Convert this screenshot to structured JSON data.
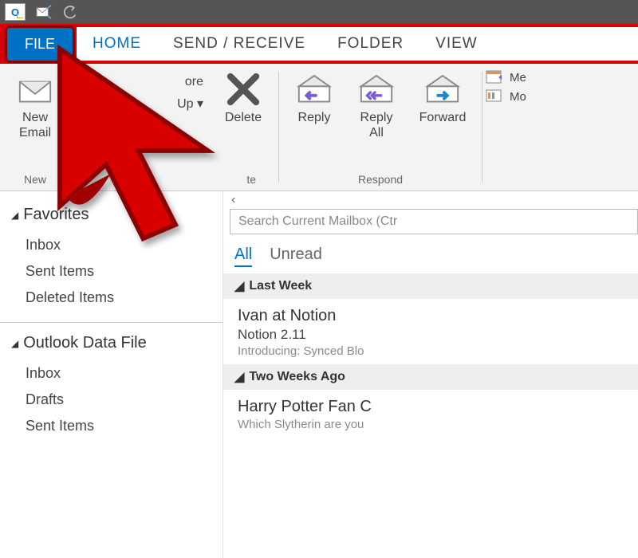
{
  "tabs": {
    "file": "FILE",
    "home": "HOME",
    "sendreceive": "SEND / RECEIVE",
    "folder": "FOLDER",
    "view": "VIEW"
  },
  "ribbon": {
    "new_email": "New\nEmail",
    "new_group": "New",
    "ignore_partial": "ore",
    "cleanup_partial": "Up ▾",
    "delete": "Delete",
    "delete_group": "te",
    "reply": "Reply",
    "reply_all": "Reply\nAll",
    "forward": "Forward",
    "respond_group": "Respond",
    "meeting_partial": "Me",
    "more_partial": "Mo"
  },
  "nav": {
    "favorites": "Favorites",
    "inbox": "Inbox",
    "sent": "Sent Items",
    "deleted": "Deleted Items",
    "datafile": "Outlook Data File",
    "drafts": "Drafts"
  },
  "mail": {
    "search_placeholder": "Search Current Mailbox (Ctr",
    "filter_all": "All",
    "filter_unread": "Unread",
    "sec_lastweek": "Last Week",
    "sec_twoweeks": "Two Weeks Ago",
    "m1_from": "Ivan at Notion",
    "m1_subj": "Notion 2.11",
    "m1_prev": "Introducing: Synced Blo",
    "m2_from": "Harry Potter Fan C",
    "m2_prev": "Which Slytherin are you "
  }
}
